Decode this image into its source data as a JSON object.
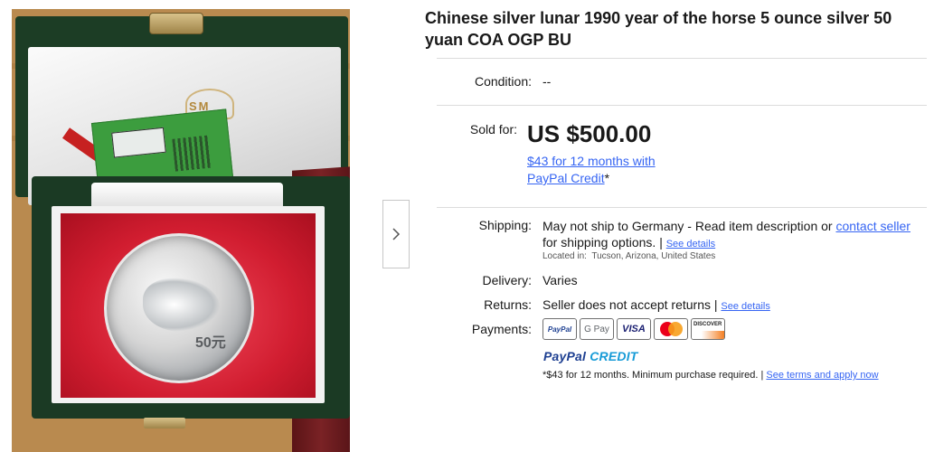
{
  "listing": {
    "title": "Chinese silver lunar 1990 year of the horse 5 ounce silver 50 yuan COA OGP BU"
  },
  "photo": {
    "description_icon": "coin-photo",
    "coin_denomination": "50元"
  },
  "gallery": {
    "next_icon": "chevron-right-icon"
  },
  "condition": {
    "label": "Condition:",
    "value": "--"
  },
  "price": {
    "label": "Sold for:",
    "amount": "US $500.00",
    "credit_line1": "$43 for 12 months with",
    "credit_line2": "PayPal Credit",
    "credit_asterisk": "*"
  },
  "shipping": {
    "label": "Shipping:",
    "text1": "May not ship to Germany - Read item description or ",
    "contact_link": "contact seller",
    "text2": "for shipping options. | ",
    "details_link": "See details",
    "location_label": "Located in:",
    "location": "Tucson, Arizona, United States"
  },
  "delivery": {
    "label": "Delivery:",
    "value": "Varies"
  },
  "returns": {
    "label": "Returns:",
    "value": "Seller does not accept returns | ",
    "details_link": "See details"
  },
  "payments": {
    "label": "Payments:",
    "methods": [
      "PayPal",
      "G Pay",
      "VISA",
      "Mastercard",
      "DISCOVER"
    ],
    "paypal_credit_brand": "PayPal",
    "paypal_credit_word": "CREDIT",
    "footnote": "*$43 for 12 months. Minimum purchase required. | ",
    "terms_link": "See terms and apply now"
  },
  "colors": {
    "link": "#3665f3",
    "text": "#191919",
    "divider": "#dcdcdc"
  }
}
